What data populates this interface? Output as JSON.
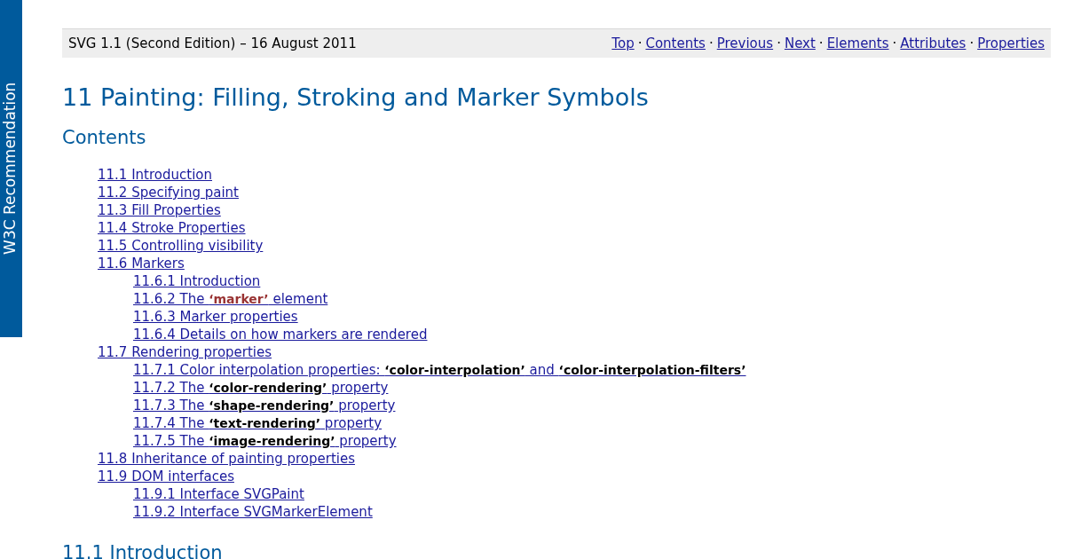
{
  "sidebar": {
    "label": "W3C Recommendation"
  },
  "header": {
    "title": "SVG 1.1 (Second Edition) – 16 August 2011",
    "nav": [
      "Top",
      "Contents",
      "Previous",
      "Next",
      "Elements",
      "Attributes",
      "Properties"
    ],
    "separator": "·"
  },
  "title": "11 Painting: Filling, Stroking and Marker Symbols",
  "contents_heading": "Contents",
  "toc": [
    {
      "text": "11.1 Introduction"
    },
    {
      "text": "11.2 Specifying paint"
    },
    {
      "text": "11.3 Fill Properties"
    },
    {
      "text": "11.4 Stroke Properties"
    },
    {
      "text": "11.5 Controlling visibility"
    },
    {
      "text": "11.6 Markers",
      "children": [
        {
          "text": "11.6.1 Introduction"
        },
        {
          "text": "11.6.2 The **‘marker’** element",
          "kind": "element"
        },
        {
          "text": "11.6.3 Marker properties"
        },
        {
          "text": "11.6.4 Details on how markers are rendered"
        }
      ]
    },
    {
      "text": "11.7 Rendering properties",
      "children": [
        {
          "text": "11.7.1 Color interpolation properties: **‘color-interpolation’** and **‘color-interpolation-filters’**",
          "kind": "property"
        },
        {
          "text": "11.7.2 The **‘color-rendering’** property",
          "kind": "property"
        },
        {
          "text": "11.7.3 The **‘shape-rendering’** property",
          "kind": "property"
        },
        {
          "text": "11.7.4 The **‘text-rendering’** property",
          "kind": "property"
        },
        {
          "text": "11.7.5 The **‘image-rendering’** property",
          "kind": "property"
        }
      ]
    },
    {
      "text": "11.8 Inheritance of painting properties"
    },
    {
      "text": "11.9 DOM interfaces",
      "children": [
        {
          "text": "11.9.1 Interface SVGPaint"
        },
        {
          "text": "11.9.2 Interface SVGMarkerElement"
        }
      ]
    }
  ],
  "section_heading": "11.1 Introduction"
}
